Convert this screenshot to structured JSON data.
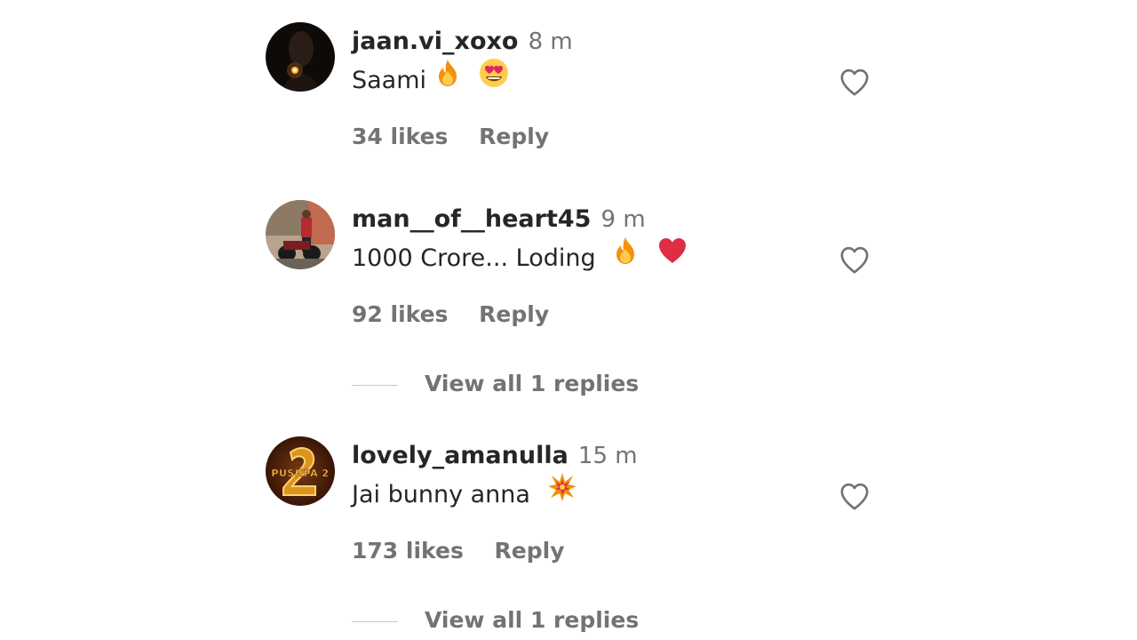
{
  "comments": [
    {
      "username": "jaan.vi_xoxo",
      "time": "8 m",
      "text": "Saami",
      "emojis": [
        "fire-emoji",
        "heart-eyes-emoji"
      ],
      "likes": "34 likes",
      "reply_label": "Reply",
      "avatar": "avatar-dark-candle"
    },
    {
      "username": "man__of__heart45",
      "time": "9 m",
      "text": "1000 Crore... Loding",
      "emojis": [
        "fire-emoji",
        "red-heart-emoji"
      ],
      "likes": "92 likes",
      "reply_label": "Reply",
      "view_replies": "View all 1 replies",
      "avatar": "avatar-motorbike"
    },
    {
      "username": "lovely_amanulla",
      "time": "15 m",
      "text": "Jai bunny anna",
      "emojis": [
        "collision-emoji"
      ],
      "likes": "173 likes",
      "reply_label": "Reply",
      "view_replies": "View all 1 replies",
      "avatar": "avatar-pushpa-2"
    }
  ],
  "avatar_logo_text": "PUSHPA 2",
  "colors": {
    "username": "#262626",
    "secondary_text": "#737373",
    "divider": "#c7c7c7",
    "heart_outline": "#737373"
  }
}
